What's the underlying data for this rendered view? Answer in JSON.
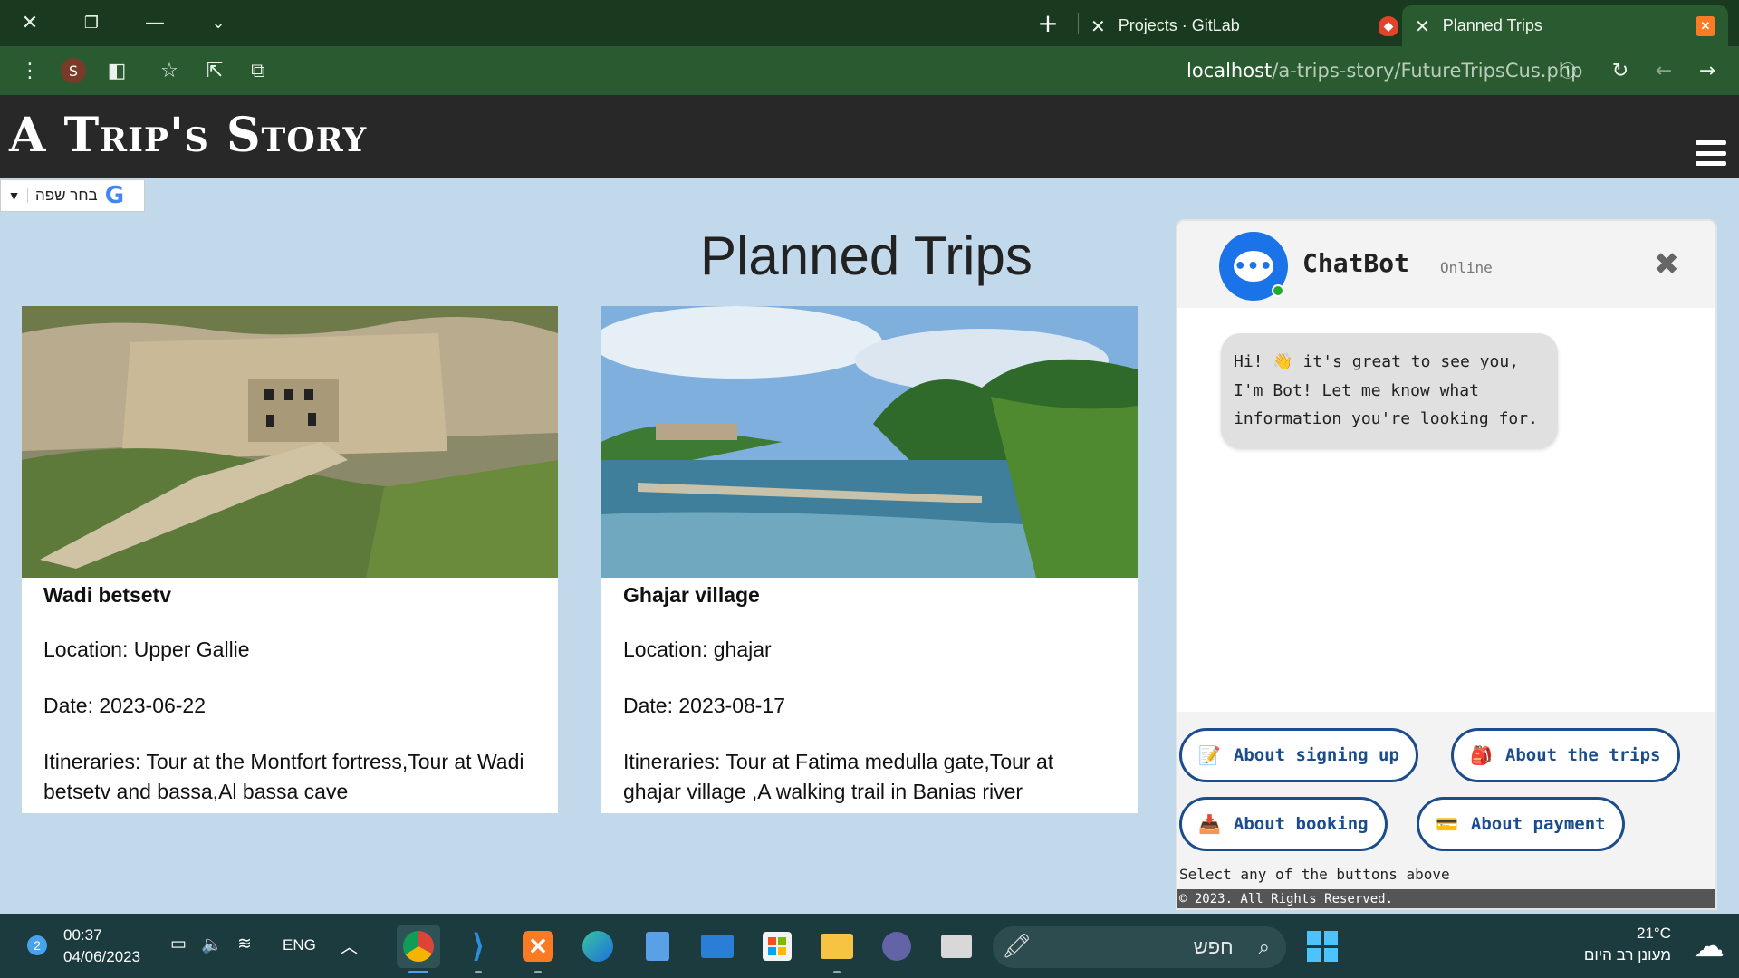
{
  "browser": {
    "tabs": [
      {
        "title": "Projects · GitLab",
        "active": false
      },
      {
        "title": "Planned Trips",
        "active": true
      }
    ],
    "profile_initial": "S",
    "url_host": "localhost",
    "url_path": "/a-trips-story/FutureTripsCus.php"
  },
  "site": {
    "brand": "A Trip's Story",
    "translate_label": "בחר שפה",
    "translate_logo": "G",
    "page_title": "Planned Trips"
  },
  "trips": [
    {
      "name": "Wadi betsetv",
      "location": "Location: Upper Gallie",
      "date": "Date: 2023-06-22",
      "itineraries": "Itineraries: Tour at the Montfort fortress,Tour at Wadi betsetv and bassa,Al bassa cave"
    },
    {
      "name": "Ghajar village",
      "location": "Location: ghajar",
      "date": "Date: 2023-08-17",
      "itineraries": "Itineraries: Tour at Fatima medulla gate,Tour at ghajar village ,A walking trail in Banias river"
    }
  ],
  "chatbot": {
    "name": "ChatBot",
    "status": "Online",
    "message": "Hi! 👋 it's great to see you, I'm Bot! Let me know what information you're looking for.",
    "buttons": [
      {
        "label": "About signing up",
        "icon": "📝"
      },
      {
        "label": "About the trips",
        "icon": "🎒"
      },
      {
        "label": "About booking",
        "icon": "📥"
      },
      {
        "label": "About payment",
        "icon": "💳"
      }
    ],
    "hint": "Select any of the buttons above",
    "copyright": "© 2023. All Rights Reserved."
  },
  "taskbar": {
    "notification_count": "2",
    "time": "00:37",
    "date": "04/06/2023",
    "language": "ENG",
    "search_placeholder": "חפש",
    "temperature": "21°C",
    "weather_text": "מעונן רב היום"
  }
}
